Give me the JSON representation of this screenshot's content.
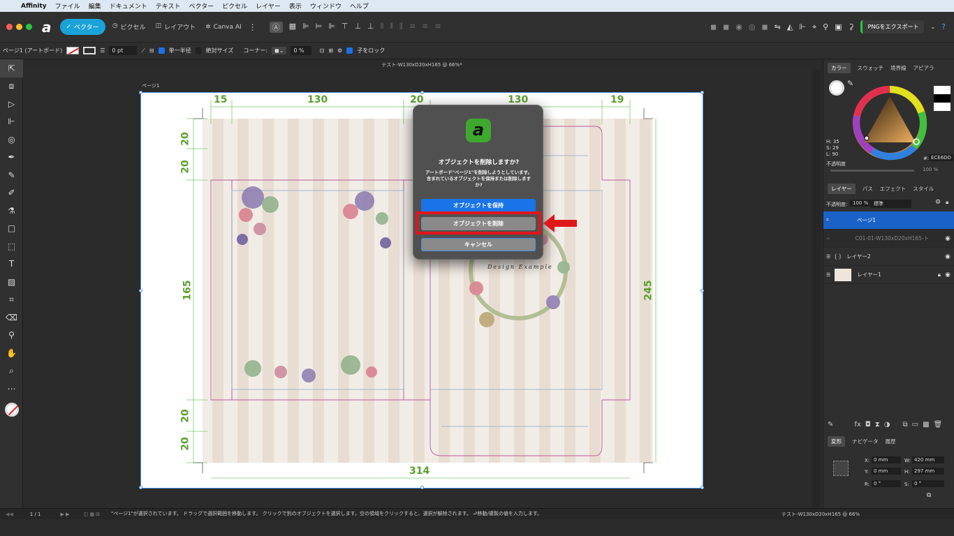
{
  "menu": {
    "apple": "",
    "items": [
      "Affinity",
      "ファイル",
      "編集",
      "ドキュメント",
      "テキスト",
      "ベクター",
      "ピクセル",
      "レイヤー",
      "表示",
      "ウィンドウ",
      "ヘルプ"
    ]
  },
  "toolbar": {
    "personas": {
      "vector": "ベクター",
      "pixel": "ピクセル",
      "layout": "レイアウト",
      "canva": "Canva AI"
    },
    "export_label": "PNGをエクスポート"
  },
  "context": {
    "artboard_label": "ページ1 (アートボード)",
    "stroke_width": "0 pt",
    "single_radius": "単一半径",
    "absolute_size": "絶対サイズ",
    "corner_label": "コーナー:",
    "corner_percent": "0 %",
    "lock_children": "子をロック"
  },
  "document": {
    "title": "テスト-W130xD20xH165 @ 66%*",
    "artboard_name": "ページ1"
  },
  "dims": {
    "top": [
      "15",
      "130",
      "20",
      "130",
      "19"
    ],
    "left": [
      "20",
      "20",
      "165",
      "20",
      "20"
    ],
    "right": "245",
    "bottom": "314"
  },
  "watermark": "Design Example",
  "dialog": {
    "title": "オブジェクトを削除しますか?",
    "message": "アートボード\"ページ1\"を削除しようとしています。含まれているオブジェクトを保持または削除しますか?",
    "keep": "オブジェクトを保持",
    "delete": "オブジェクトを削除",
    "cancel": "キャンセル"
  },
  "color_panel": {
    "tabs": [
      "カラー",
      "スウォッチ",
      "境界線",
      "アピアラ"
    ],
    "h": "H: 35",
    "s": "S: 29",
    "l": "L: 90",
    "opacity_label": "不透明度",
    "hex_label": "#:",
    "hex": "ECE6DD",
    "opacity_value": "100 %"
  },
  "layers_panel": {
    "tabs": [
      "レイヤー",
      "パス",
      "エフェクト",
      "スタイル"
    ],
    "opacity_label": "不透明度:",
    "opacity": "100 %",
    "blend": "標準",
    "layers": [
      {
        "name": "ページ1"
      },
      {
        "name": "C01-01-W130xD20xH165-ト"
      },
      {
        "name": "レイヤー2"
      },
      {
        "name": "レイヤー1"
      }
    ]
  },
  "transform_panel": {
    "tabs": [
      "変形",
      "ナビゲータ",
      "履歴"
    ],
    "x_label": "X:",
    "x": "0 mm",
    "y_label": "Y:",
    "y": "0 mm",
    "w_label": "W:",
    "w": "420 mm",
    "h_label": "H:",
    "h": "297 mm",
    "r_label": "R:",
    "r": "0 °",
    "s_label": "S:",
    "s": "0 °"
  },
  "status": {
    "page": "1 / 1",
    "message": "\"ページ1\"が選択されています。 ドラッグで選択範囲を移動します。 クリックで別のオブジェクトを選択します。空の領域をクリックすると、選択が解除されます。 ⮐移動/複製の値を入力します。",
    "right": "テスト-W130xD20xH165 @ 66%"
  },
  "colors": {
    "accent": "#1a73e8",
    "highlight": "#e0161b",
    "dim_green": "#5aa02c"
  }
}
